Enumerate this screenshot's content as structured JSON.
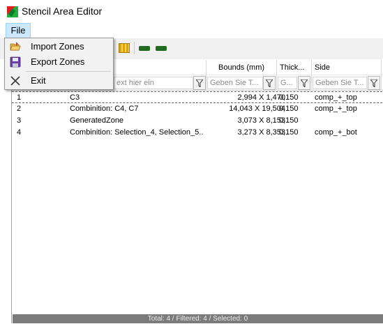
{
  "window": {
    "title": "Stencil Area Editor"
  },
  "menubar": {
    "file_label": "File"
  },
  "file_menu": {
    "import_label": "Import Zones",
    "export_label": "Export Zones",
    "exit_label": "Exit"
  },
  "columns": {
    "bounds": "Bounds (mm)",
    "thickness": "Thick...",
    "side": "Side"
  },
  "filters": {
    "name_placeholder": "ext hier ein",
    "bounds_placeholder": "Geben Sie T...",
    "thickness_placeholder": "G...",
    "side_placeholder": "Geben Sie T..."
  },
  "rows": [
    {
      "idx": "1",
      "name": "C3",
      "bounds": "2,994 X 1,470",
      "thickness": "0,150",
      "side": "comp_+_top"
    },
    {
      "idx": "2",
      "name": "Combinition: C4, C7",
      "bounds": "14,043 X 19,504",
      "thickness": "0,150",
      "side": "comp_+_top"
    },
    {
      "idx": "3",
      "name": "GeneratedZone",
      "bounds": "3,073 X 8,153",
      "thickness": "0,150",
      "side": ""
    },
    {
      "idx": "4",
      "name": "Combinition: Selection_4, Selection_5...",
      "bounds": "3,273 X 8,353",
      "thickness": "0,150",
      "side": "comp_+_bot"
    }
  ],
  "status": {
    "text": "Total: 4 / Filtered: 4 / Selected: 0"
  },
  "icons": {
    "app": "stencil-app-icon",
    "import": "folder-open-icon",
    "export": "floppy-disk-icon",
    "exit": "close-x-icon",
    "filter": "funnel-icon"
  },
  "colors": {
    "menu_highlight": "#cce8ff",
    "statusbar": "#7b7b7b",
    "menu_bg": "#f2f2f2"
  }
}
